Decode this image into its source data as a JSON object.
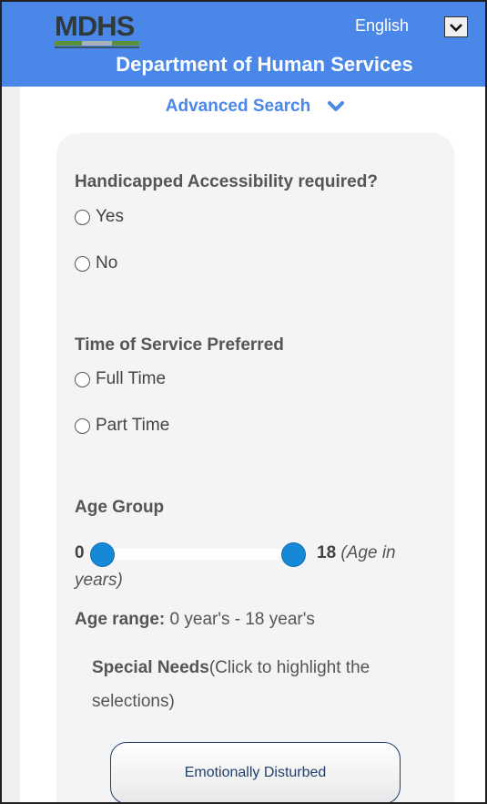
{
  "header": {
    "logo_text": "MDHS",
    "language": {
      "selected": "English"
    },
    "department_title": "Department of Human Services"
  },
  "advanced_search": {
    "label": "Advanced Search",
    "icon": "chevron-down-icon"
  },
  "accessibility": {
    "label": "Handicapped Accessibility required?",
    "options": [
      "Yes",
      "No"
    ]
  },
  "service_time": {
    "label": "Time of Service Preferred",
    "options": [
      "Full Time",
      "Part Time"
    ]
  },
  "age_group": {
    "label": "Age Group",
    "min": "0",
    "max": "18",
    "unit_start": "(Age in",
    "unit_end": "years)",
    "range_label": "Age range:",
    "range_value": "0 year's - 18 year's"
  },
  "special_needs": {
    "label": "Special Needs",
    "hint": "(Click to highlight the selections)",
    "options": [
      "Emotionally Disturbed"
    ]
  },
  "colors": {
    "header_bg": "#4a87e8",
    "accent": "#4a87e8",
    "slider_handle": "#1589d6",
    "button_text": "#1f3f6e"
  }
}
